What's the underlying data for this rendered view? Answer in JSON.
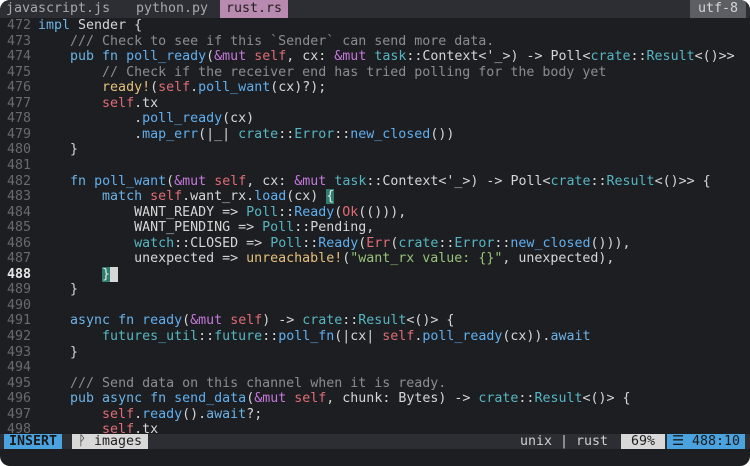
{
  "tabs": [
    {
      "label": "javascript.js",
      "active": false
    },
    {
      "label": "python.py",
      "active": false
    },
    {
      "label": "rust.rs",
      "active": true
    }
  ],
  "encoding": "utf-8",
  "colors": {
    "mode_bg": "#4aa3df",
    "active_tab_bg": "#b98ab0",
    "editor_bg": "#1c1e21"
  },
  "lines": [
    {
      "n": "472",
      "html": "<span class='k'>impl</span> Sender {"
    },
    {
      "n": "473",
      "html": "    <span class='c'>/// Check to see if this `Sender` can send more data.</span>"
    },
    {
      "n": "474",
      "html": "    <span class='k'>pub fn</span> <span class='f'>poll_ready</span>(<span class='p'>&amp;mut</span> <span class='self'>self</span>, cx: <span class='p'>&amp;mut</span> <span class='t'>task</span>::Context&lt;'_&gt;) -&gt; Poll&lt;<span class='t'>crate</span>::<span class='t'>Result</span>&lt;()&gt;&gt;"
    },
    {
      "n": "475",
      "html": "        <span class='c'>// Check if the receiver end has tried polling for the body yet</span>"
    },
    {
      "n": "476",
      "html": "        <span class='m'>ready!</span>(<span class='self'>self</span>.<span class='f'>poll_want</span>(cx)?);"
    },
    {
      "n": "477",
      "html": "        <span class='self'>self</span>.tx"
    },
    {
      "n": "478",
      "html": "            .<span class='f'>poll_ready</span>(cx)"
    },
    {
      "n": "479",
      "html": "            .<span class='f'>map_err</span>(|_| <span class='t'>crate</span>::<span class='t'>Error</span>::<span class='f'>new_closed</span>())"
    },
    {
      "n": "480",
      "html": "    }"
    },
    {
      "n": "481",
      "html": ""
    },
    {
      "n": "482",
      "html": "    <span class='k'>fn</span> <span class='f'>poll_want</span>(<span class='p'>&amp;mut</span> <span class='self'>self</span>, cx: <span class='p'>&amp;mut</span> <span class='t'>task</span>::Context&lt;'_&gt;) -&gt; Poll&lt;<span class='t'>crate</span>::<span class='t'>Result</span>&lt;()&gt;&gt; {"
    },
    {
      "n": "483",
      "html": "        <span class='k'>match</span> <span class='self'>self</span>.want_rx.<span class='f'>load</span>(cx) <span class='match-br'>{</span>"
    },
    {
      "n": "484",
      "html": "            WANT_READY =&gt; <span class='t'>Poll</span>::<span class='f'>Ready</span>(<span class='self'>Ok</span>(())),"
    },
    {
      "n": "485",
      "html": "            WANT_PENDING =&gt; <span class='t'>Poll</span>::Pending,"
    },
    {
      "n": "486",
      "html": "            <span class='t'>watch</span>::CLOSED =&gt; <span class='t'>Poll</span>::<span class='f'>Ready</span>(<span class='self'>Err</span>(<span class='t'>crate</span>::<span class='t'>Error</span>::<span class='f'>new_closed</span>())),"
    },
    {
      "n": "487",
      "html": "            unexpected =&gt; <span class='m'>unreachable!</span>(<span class='s'>\"want_rx value: {}\"</span>, unexpected),"
    },
    {
      "n": "488",
      "html": "        <span class='match-br'>}</span><span class='cur-box'> </span>",
      "current": true
    },
    {
      "n": "489",
      "html": "    }"
    },
    {
      "n": "490",
      "html": ""
    },
    {
      "n": "491",
      "html": "    <span class='k'>async fn</span> <span class='f'>ready</span>(<span class='p'>&amp;mut</span> <span class='self'>self</span>) -&gt; <span class='t'>crate</span>::<span class='t'>Result</span>&lt;()&gt; {"
    },
    {
      "n": "492",
      "html": "        <span class='t'>futures_util</span>::<span class='t'>future</span>::<span class='f'>poll_fn</span>(|cx| <span class='self'>self</span>.<span class='f'>poll_ready</span>(cx)).<span class='k'>await</span>"
    },
    {
      "n": "493",
      "html": "    }"
    },
    {
      "n": "494",
      "html": ""
    },
    {
      "n": "495",
      "html": "    <span class='c'>/// Send data on this channel when it is ready.</span>"
    },
    {
      "n": "496",
      "html": "    <span class='k'>pub async fn</span> <span class='f'>send_data</span>(<span class='p'>&amp;mut</span> <span class='self'>self</span>, chunk: Bytes) -&gt; <span class='t'>crate</span>::<span class='t'>Result</span>&lt;()&gt; {"
    },
    {
      "n": "497",
      "html": "        <span class='self'>self</span>.<span class='f'>ready</span>().<span class='k'>await</span>?;"
    },
    {
      "n": "498",
      "html": "        <span class='self'>self</span>.tx"
    }
  ],
  "status": {
    "mode": "INSERT",
    "branch": "ᚹ images",
    "filetype": "unix | rust",
    "percent": "69%",
    "position": "☰ 488:10"
  }
}
